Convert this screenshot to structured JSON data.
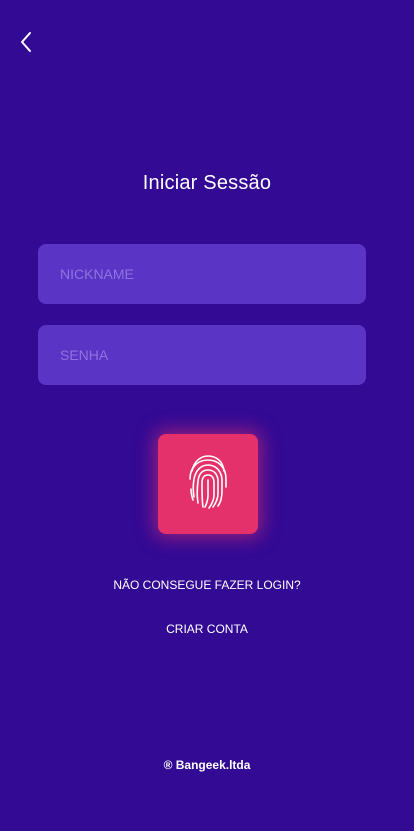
{
  "header": {
    "back_icon": "chevron-left-icon"
  },
  "login": {
    "title": "Iniciar Sessão",
    "nickname_placeholder": "NICKNAME",
    "password_placeholder": "SENHA",
    "fingerprint_icon": "fingerprint-icon",
    "forgot_label": "NÃO CONSEGUE FAZER LOGIN?",
    "create_label": "CRIAR CONTA"
  },
  "footer": {
    "text": "® Bangeek.ltda"
  },
  "colors": {
    "background": "#330A94",
    "field": "#5A34C4",
    "placeholder": "#8F74E0",
    "accent": "#E4306B"
  }
}
